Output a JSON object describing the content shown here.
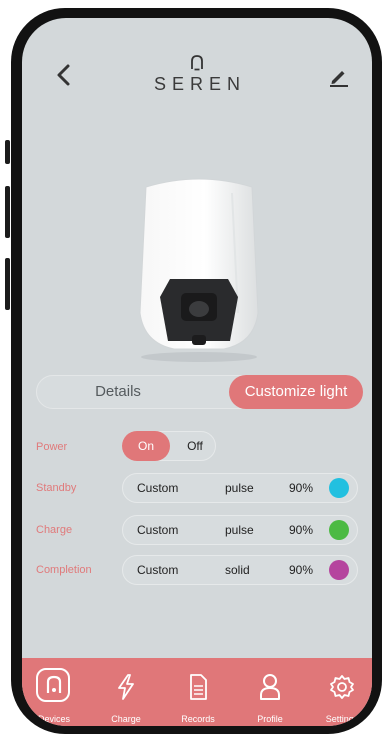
{
  "brand": {
    "name": "SEREN"
  },
  "tabs": {
    "details": "Details",
    "customize": "Customize light"
  },
  "settings": {
    "power": {
      "label": "Power",
      "on": "On",
      "off": "Off"
    },
    "rows": [
      {
        "label": "Standby",
        "mode": "Custom",
        "effect": "pulse",
        "brightness": "90%",
        "color": "#22c0e0"
      },
      {
        "label": "Charge",
        "mode": "Custom",
        "effect": "pulse",
        "brightness": "90%",
        "color": "#4cba43"
      },
      {
        "label": "Completion",
        "mode": "Custom",
        "effect": "solid",
        "brightness": "90%",
        "color": "#b5449e"
      }
    ]
  },
  "nav": {
    "items": [
      {
        "label": "Devices",
        "icon": "charger-icon"
      },
      {
        "label": "Charge",
        "icon": "lightning-icon"
      },
      {
        "label": "Records",
        "icon": "document-icon"
      },
      {
        "label": "Profile",
        "icon": "profile-icon"
      },
      {
        "label": "Settings",
        "icon": "gear-icon"
      }
    ]
  },
  "colors": {
    "accent": "#e07779",
    "screen": "#d3d8da",
    "label": "#e07a7b"
  }
}
